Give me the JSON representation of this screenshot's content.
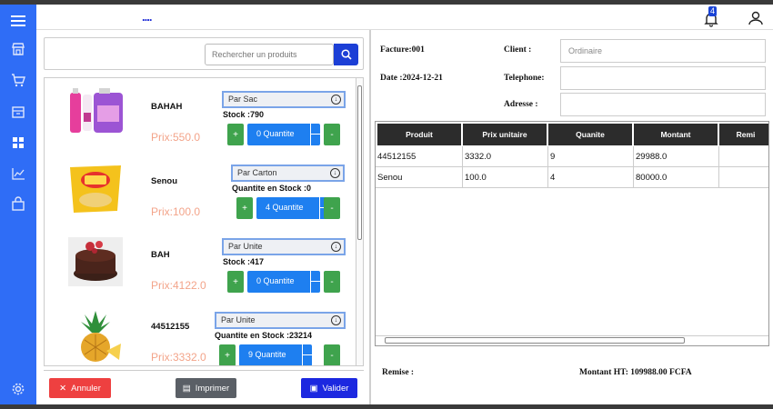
{
  "topbar": {
    "dots": "....",
    "notification_count": "4"
  },
  "search": {
    "placeholder": "Rechercher un produits"
  },
  "products": [
    {
      "name": "BAHAH",
      "price": "Prix:550.0",
      "unit": "Par Sac",
      "stock": "Stock :790",
      "quantity": "0 Quantite",
      "plus": "+",
      "minus": "-"
    },
    {
      "name": "Senou",
      "price": "Prix:100.0",
      "unit": "Par Carton",
      "stock": "Quantite en Stock :0",
      "quantity": "4 Quantite",
      "plus": "+",
      "minus": "-"
    },
    {
      "name": "BAH",
      "price": "Prix:4122.0",
      "unit": "Par Unite",
      "stock": "Stock :417",
      "quantity": "0 Quantite",
      "plus": "+",
      "minus": "-"
    },
    {
      "name": "44512155",
      "price": "Prix:3332.0",
      "unit": "Par Unite",
      "stock": "Quantite en Stock :23214",
      "quantity": "9 Quantite",
      "plus": "+",
      "minus": "-"
    }
  ],
  "footer": {
    "cancel": "Annuler",
    "print": "Imprimer",
    "validate": "Valider"
  },
  "invoice": {
    "facture": "Facture:001",
    "date": "Date :2024-12-21",
    "client_label": "Client :",
    "client_value": "Ordinaire",
    "phone_label": "Telephone:",
    "phone_value": "",
    "address_label": "Adresse :",
    "address_value": ""
  },
  "table": {
    "headers": [
      "Produit",
      "Prix unitaire",
      "Quanite",
      "Montant",
      "Remi"
    ],
    "rows": [
      [
        "44512155",
        "3332.0",
        "9",
        "29988.0",
        ""
      ],
      [
        "Senou",
        "100.0",
        "4",
        "80000.0",
        ""
      ]
    ]
  },
  "summary": {
    "remise": "Remise :",
    "montant": "Montant HT: 109988.00 FCFA"
  },
  "colors": {
    "sidebar": "#2f6df6",
    "green": "#3fa34d",
    "blue": "#1e7ff0",
    "red": "#ee4040",
    "price": "#f3a48a"
  }
}
